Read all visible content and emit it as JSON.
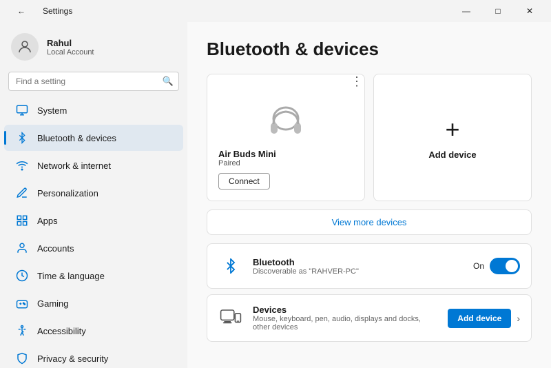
{
  "titlebar": {
    "back_icon": "←",
    "title": "Settings",
    "min_label": "—",
    "max_label": "□",
    "close_label": "✕"
  },
  "sidebar": {
    "user": {
      "name": "Rahul",
      "account_type": "Local Account"
    },
    "search": {
      "placeholder": "Find a setting",
      "icon": "🔍"
    },
    "nav_items": [
      {
        "id": "system",
        "label": "System",
        "icon": "system"
      },
      {
        "id": "bluetooth",
        "label": "Bluetooth & devices",
        "icon": "bluetooth",
        "active": true
      },
      {
        "id": "network",
        "label": "Network & internet",
        "icon": "network"
      },
      {
        "id": "personalization",
        "label": "Personalization",
        "icon": "personalization"
      },
      {
        "id": "apps",
        "label": "Apps",
        "icon": "apps"
      },
      {
        "id": "accounts",
        "label": "Accounts",
        "icon": "accounts"
      },
      {
        "id": "time",
        "label": "Time & language",
        "icon": "time"
      },
      {
        "id": "gaming",
        "label": "Gaming",
        "icon": "gaming"
      },
      {
        "id": "accessibility",
        "label": "Accessibility",
        "icon": "accessibility"
      },
      {
        "id": "privacy",
        "label": "Privacy & security",
        "icon": "privacy"
      }
    ]
  },
  "content": {
    "page_title": "Bluetooth & devices",
    "device_card": {
      "menu_dots": "⋮",
      "device_name": "Air Buds Mini",
      "device_status": "Paired",
      "connect_label": "Connect"
    },
    "add_device_card": {
      "icon": "+",
      "label": "Add device"
    },
    "view_more_label": "View more devices",
    "bluetooth_row": {
      "title": "Bluetooth",
      "subtitle": "Discoverable as \"RAHVER-PC\"",
      "on_label": "On"
    },
    "devices_row": {
      "title": "Devices",
      "subtitle": "Mouse, keyboard, pen, audio, displays and docks, other devices",
      "add_label": "Add device",
      "chevron": "›"
    }
  }
}
